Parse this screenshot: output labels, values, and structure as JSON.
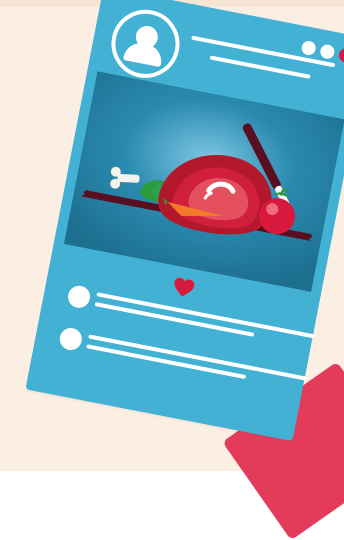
{
  "colors": {
    "background": "#fbeee2",
    "background_strip": "#f7e6d4",
    "card": "#43b1d3",
    "photo_base": "#1d6f8f",
    "photo_mid": "#2a8ab0",
    "photo_light": "#7fc8e3",
    "dot_white": "#ffffff",
    "dot_accent": "#d7193e",
    "heart": "#d7193e",
    "accent": "#e53b5b"
  },
  "icons": {
    "avatar": "user-avatar-icon",
    "menu_dots": "menu-dots-icon",
    "heart": "heart-icon",
    "food_illustration": "roast-meat-illustration"
  }
}
